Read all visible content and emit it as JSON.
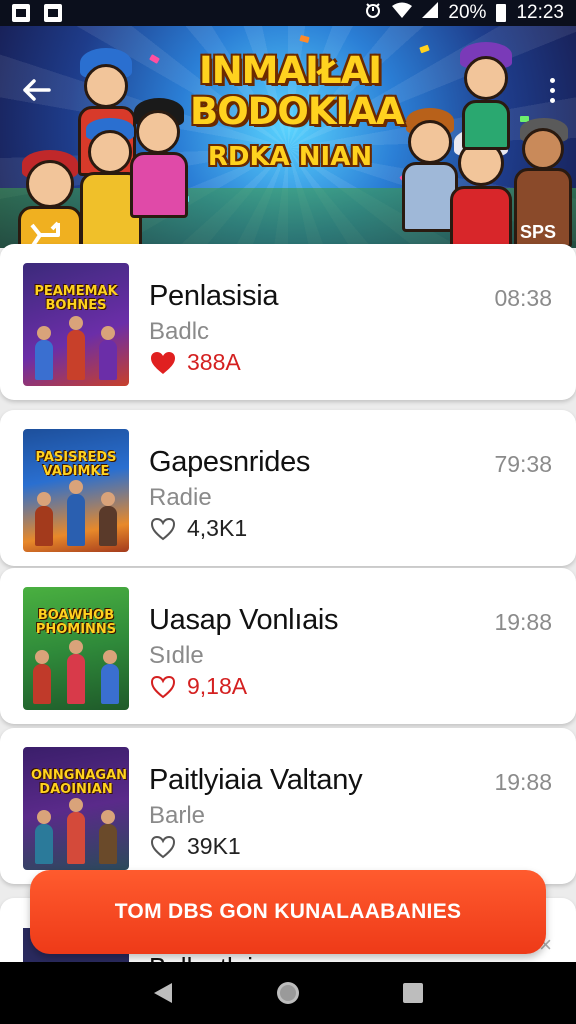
{
  "status_bar": {
    "battery_percent": "20%",
    "time": "12:23",
    "icons": [
      "image-icon",
      "notification-icon",
      "alarm-icon",
      "wifi-icon",
      "signal-icon",
      "battery-icon"
    ]
  },
  "hero": {
    "title_line1": "INMAIŁAI",
    "title_line2": "BODOKIAA",
    "title_line3": "RDKA NIAN",
    "tag": "SPS",
    "icons": [
      "back-arrow-icon",
      "more-vert-icon",
      "share-icon"
    ]
  },
  "games": [
    {
      "title": "Penlasisia",
      "subtitle": "Badlc",
      "time": "08:38",
      "likes": "388A",
      "liked": true,
      "thumb_title": "PEAMEMAK BOHNES",
      "thumb_colors": [
        "#3b2a7a",
        "#c8402a",
        "#6b2ea8"
      ]
    },
    {
      "title": "Gapesnrides",
      "subtitle": "Radie",
      "time": "79:38",
      "likes": "4,3K1",
      "liked": false,
      "thumb_title": "PASISREDS VADIMKE",
      "thumb_colors": [
        "#1d4f9b",
        "#e8892a",
        "#a33a1c"
      ]
    },
    {
      "title": "Uasap Vonlıais",
      "subtitle": "Sıdle",
      "time": "19:88",
      "likes": "9,18A",
      "liked": false,
      "thumb_title": "BOAWHOB PHOMINNS",
      "thumb_colors": [
        "#2f8a3a",
        "#c03a2a",
        "#3a6fd0"
      ]
    },
    {
      "title": "Paitlyiaia Valtany",
      "subtitle": "Barle",
      "time": "19:88",
      "likes": "39K1",
      "liked": false,
      "thumb_title": "ONNGNAGAN DAOINIAN",
      "thumb_colors": [
        "#3a1e6a",
        "#d44a8a",
        "#2b7a5a"
      ]
    }
  ],
  "peek_item": {
    "title": "Ballvatlais",
    "close": "×"
  },
  "cta": {
    "label": "TOM DBS GON KUNALAABANIES"
  },
  "nav_bar": {
    "icons": [
      "back-triangle-icon",
      "home-circle-icon",
      "recents-square-icon"
    ]
  },
  "colors": {
    "accent": "#ee3a18",
    "heart_red": "#e02020",
    "card_bg": "#ffffff",
    "page_bg": "#ececec"
  }
}
